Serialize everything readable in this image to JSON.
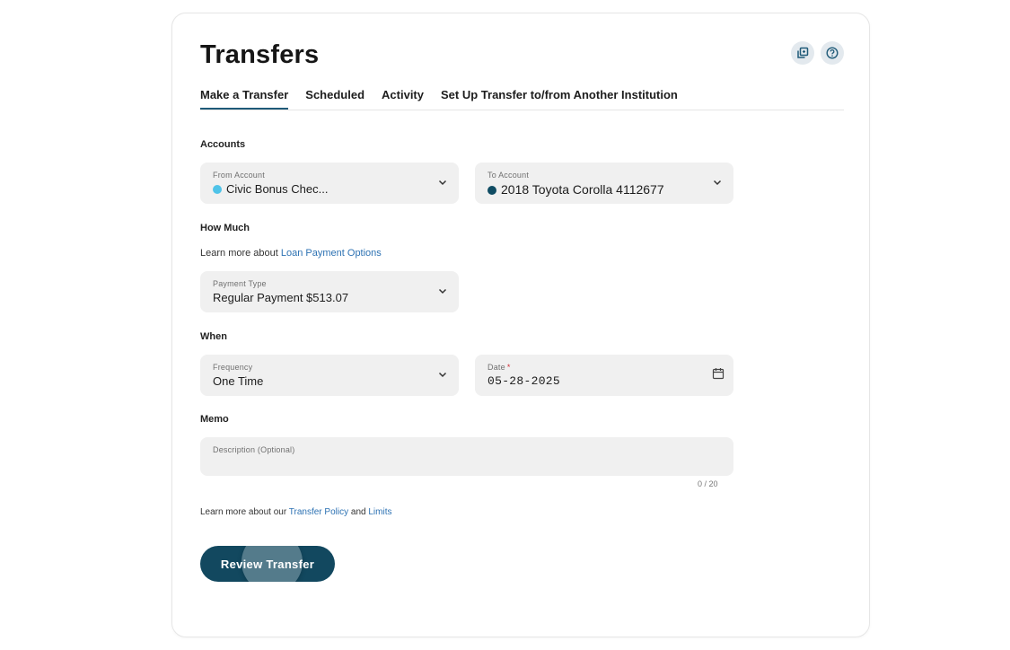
{
  "page": {
    "title": "Transfers",
    "icons": [
      "copy-icon",
      "help-icon"
    ]
  },
  "tabs": [
    {
      "label": "Make a Transfer",
      "active": true
    },
    {
      "label": "Scheduled",
      "active": false
    },
    {
      "label": "Activity",
      "active": false
    },
    {
      "label": "Set Up Transfer to/from Another Institution",
      "active": false
    }
  ],
  "accounts": {
    "section_label": "Accounts",
    "from": {
      "label": "From Account",
      "value": "Civic Bonus Chec...",
      "dot_color": "#4fc3e8"
    },
    "to": {
      "label": "To Account",
      "value": "2018 Toyota Corolla 4112677",
      "dot_color": "#0f4c63"
    }
  },
  "how_much": {
    "section_label": "How Much",
    "learn_prefix": "Learn more about ",
    "learn_link": "Loan Payment Options",
    "payment_type": {
      "label": "Payment Type",
      "value": "Regular Payment $513.07"
    }
  },
  "when": {
    "section_label": "When",
    "frequency": {
      "label": "Frequency",
      "value": "One Time"
    },
    "date": {
      "label": "Date",
      "required_mark": "*",
      "value": "05-28-2025"
    }
  },
  "memo": {
    "section_label": "Memo",
    "placeholder": "Description (Optional)",
    "counter": "0 / 20"
  },
  "policy": {
    "prefix": "Learn more about our ",
    "policy_link": "Transfer Policy",
    "and": " and ",
    "limits_link": "Limits"
  },
  "actions": {
    "review_label": "Review Transfer"
  },
  "colors": {
    "accent": "#12485f",
    "link": "#2d72b3",
    "field_bg": "#f0f0f0"
  }
}
